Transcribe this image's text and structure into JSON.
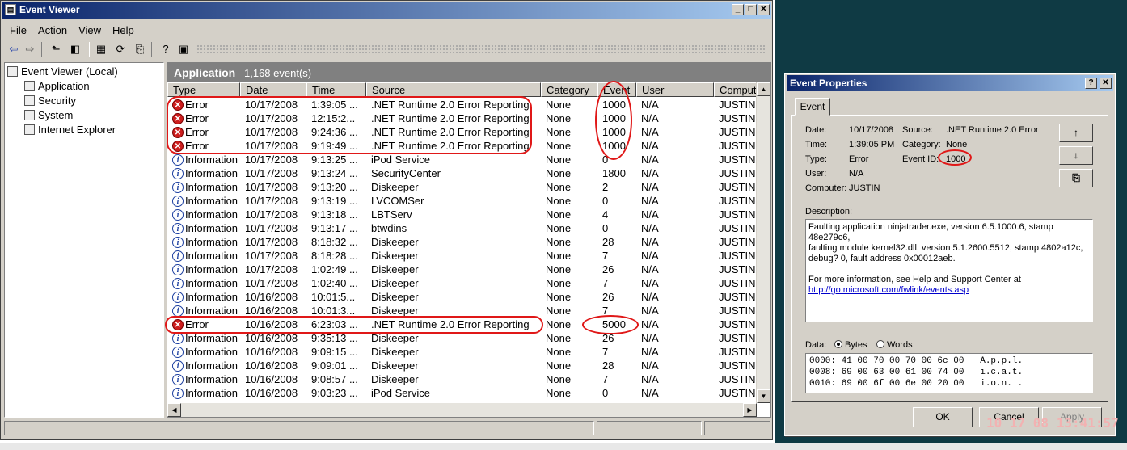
{
  "window": {
    "title": "Event Viewer",
    "minimize": "_",
    "maximize": "□",
    "close": "✕"
  },
  "menu": [
    "File",
    "Action",
    "View",
    "Help"
  ],
  "toolbar_icons": [
    "back-icon",
    "forward-icon",
    "up-icon",
    "show-hide-tree-icon",
    "properties-icon",
    "refresh-icon",
    "export-icon",
    "help-icon",
    "console-icon"
  ],
  "tree": {
    "root": "Event Viewer (Local)",
    "children": [
      "Application",
      "Security",
      "System",
      "Internet Explorer"
    ]
  },
  "list": {
    "title": "Application",
    "count": "1,168 event(s)",
    "columns": [
      "Type",
      "Date",
      "Time",
      "Source",
      "Category",
      "Event",
      "User",
      "Computer"
    ],
    "rows": [
      {
        "type": "Error",
        "icon": "error-icon",
        "date": "10/17/2008",
        "time": "1:39:05 ...",
        "source": ".NET Runtime 2.0 Error Reporting",
        "category": "None",
        "event": "1000",
        "user": "N/A",
        "computer": "JUSTIN"
      },
      {
        "type": "Error",
        "icon": "error-icon",
        "date": "10/17/2008",
        "time": "12:15:2...",
        "source": ".NET Runtime 2.0 Error Reporting",
        "category": "None",
        "event": "1000",
        "user": "N/A",
        "computer": "JUSTIN"
      },
      {
        "type": "Error",
        "icon": "error-icon",
        "date": "10/17/2008",
        "time": "9:24:36 ...",
        "source": ".NET Runtime 2.0 Error Reporting",
        "category": "None",
        "event": "1000",
        "user": "N/A",
        "computer": "JUSTIN"
      },
      {
        "type": "Error",
        "icon": "error-icon",
        "date": "10/17/2008",
        "time": "9:19:49 ...",
        "source": ".NET Runtime 2.0 Error Reporting",
        "category": "None",
        "event": "1000",
        "user": "N/A",
        "computer": "JUSTIN"
      },
      {
        "type": "Information",
        "icon": "info-icon",
        "date": "10/17/2008",
        "time": "9:13:25 ...",
        "source": "iPod Service",
        "category": "None",
        "event": "0",
        "user": "N/A",
        "computer": "JUSTIN"
      },
      {
        "type": "Information",
        "icon": "info-icon",
        "date": "10/17/2008",
        "time": "9:13:24 ...",
        "source": "SecurityCenter",
        "category": "None",
        "event": "1800",
        "user": "N/A",
        "computer": "JUSTIN"
      },
      {
        "type": "Information",
        "icon": "info-icon",
        "date": "10/17/2008",
        "time": "9:13:20 ...",
        "source": "Diskeeper",
        "category": "None",
        "event": "2",
        "user": "N/A",
        "computer": "JUSTIN"
      },
      {
        "type": "Information",
        "icon": "info-icon",
        "date": "10/17/2008",
        "time": "9:13:19 ...",
        "source": "LVCOMSer",
        "category": "None",
        "event": "0",
        "user": "N/A",
        "computer": "JUSTIN"
      },
      {
        "type": "Information",
        "icon": "info-icon",
        "date": "10/17/2008",
        "time": "9:13:18 ...",
        "source": "LBTServ",
        "category": "None",
        "event": "4",
        "user": "N/A",
        "computer": "JUSTIN"
      },
      {
        "type": "Information",
        "icon": "info-icon",
        "date": "10/17/2008",
        "time": "9:13:17 ...",
        "source": "btwdins",
        "category": "None",
        "event": "0",
        "user": "N/A",
        "computer": "JUSTIN"
      },
      {
        "type": "Information",
        "icon": "info-icon",
        "date": "10/17/2008",
        "time": "8:18:32 ...",
        "source": "Diskeeper",
        "category": "None",
        "event": "28",
        "user": "N/A",
        "computer": "JUSTIN"
      },
      {
        "type": "Information",
        "icon": "info-icon",
        "date": "10/17/2008",
        "time": "8:18:28 ...",
        "source": "Diskeeper",
        "category": "None",
        "event": "7",
        "user": "N/A",
        "computer": "JUSTIN"
      },
      {
        "type": "Information",
        "icon": "info-icon",
        "date": "10/17/2008",
        "time": "1:02:49 ...",
        "source": "Diskeeper",
        "category": "None",
        "event": "26",
        "user": "N/A",
        "computer": "JUSTIN"
      },
      {
        "type": "Information",
        "icon": "info-icon",
        "date": "10/17/2008",
        "time": "1:02:40 ...",
        "source": "Diskeeper",
        "category": "None",
        "event": "7",
        "user": "N/A",
        "computer": "JUSTIN"
      },
      {
        "type": "Information",
        "icon": "info-icon",
        "date": "10/16/2008",
        "time": "10:01:5...",
        "source": "Diskeeper",
        "category": "None",
        "event": "26",
        "user": "N/A",
        "computer": "JUSTIN"
      },
      {
        "type": "Information",
        "icon": "info-icon",
        "date": "10/16/2008",
        "time": "10:01:3...",
        "source": "Diskeeper",
        "category": "None",
        "event": "7",
        "user": "N/A",
        "computer": "JUSTIN"
      },
      {
        "type": "Error",
        "icon": "error-icon",
        "date": "10/16/2008",
        "time": "6:23:03 ...",
        "source": ".NET Runtime 2.0 Error Reporting",
        "category": "None",
        "event": "5000",
        "user": "N/A",
        "computer": "JUSTIN"
      },
      {
        "type": "Information",
        "icon": "info-icon",
        "date": "10/16/2008",
        "time": "9:35:13 ...",
        "source": "Diskeeper",
        "category": "None",
        "event": "26",
        "user": "N/A",
        "computer": "JUSTIN"
      },
      {
        "type": "Information",
        "icon": "info-icon",
        "date": "10/16/2008",
        "time": "9:09:15 ...",
        "source": "Diskeeper",
        "category": "None",
        "event": "7",
        "user": "N/A",
        "computer": "JUSTIN"
      },
      {
        "type": "Information",
        "icon": "info-icon",
        "date": "10/16/2008",
        "time": "9:09:01 ...",
        "source": "Diskeeper",
        "category": "None",
        "event": "28",
        "user": "N/A",
        "computer": "JUSTIN"
      },
      {
        "type": "Information",
        "icon": "info-icon",
        "date": "10/16/2008",
        "time": "9:08:57 ...",
        "source": "Diskeeper",
        "category": "None",
        "event": "7",
        "user": "N/A",
        "computer": "JUSTIN"
      },
      {
        "type": "Information",
        "icon": "info-icon",
        "date": "10/16/2008",
        "time": "9:03:23 ...",
        "source": "iPod Service",
        "category": "None",
        "event": "0",
        "user": "N/A",
        "computer": "JUSTIN"
      }
    ]
  },
  "dialog": {
    "title": "Event Properties",
    "help": "?",
    "close": "✕",
    "tab": "Event",
    "fields": {
      "date_label": "Date:",
      "date": "10/17/2008",
      "source_label": "Source:",
      "source": ".NET Runtime 2.0 Error",
      "time_label": "Time:",
      "time": "1:39:05 PM",
      "category_label": "Category:",
      "category": "None",
      "type_label": "Type:",
      "type": "Error",
      "eventid_label": "Event ID:",
      "eventid": "1000",
      "user_label": "User:",
      "user": "N/A",
      "computer_label": "Computer:",
      "computer": "JUSTIN"
    },
    "description_label": "Description:",
    "description_lines": [
      "Faulting application ninjatrader.exe, version 6.5.1000.6, stamp 48e279c6,",
      "faulting module kernel32.dll, version 5.1.2600.5512, stamp 4802a12c,",
      "debug? 0, fault address 0x00012aeb.",
      "",
      "For more information, see Help and Support Center at"
    ],
    "description_link": "http://go.microsoft.com/fwlink/events.asp",
    "data_label": "Data:",
    "bytes_label": "Bytes",
    "words_label": "Words",
    "data_lines": [
      "0000: 41 00 70 00 70 00 6c 00   A.p.p.l.",
      "0008: 69 00 63 00 61 00 74 00   i.c.a.t.",
      "0010: 69 00 6f 00 6e 00 20 00   i.o.n. ."
    ],
    "ok": "OK",
    "cancel": "Cancel",
    "apply": "Apply"
  },
  "stamp": "10 17 08 13:41:57",
  "accent_red": "#e01818"
}
